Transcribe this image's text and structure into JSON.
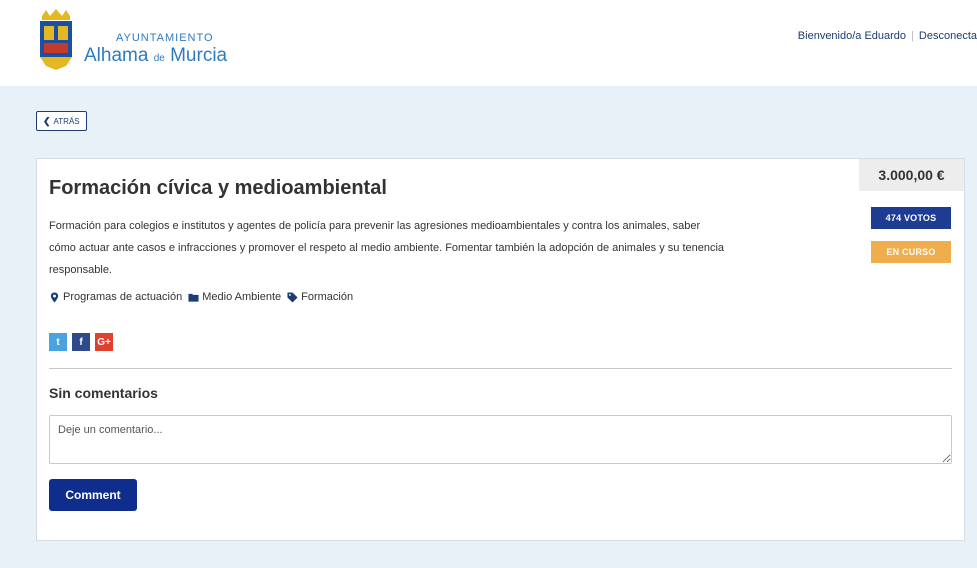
{
  "header": {
    "logo_top": "AYUNTAMIENTO",
    "logo_main": "Alhama",
    "logo_de": "de",
    "logo_city": "Murcia",
    "welcome": "Bienvenido/a Eduardo",
    "logout": "Desconecta"
  },
  "back": {
    "label": "ATRÁS"
  },
  "project": {
    "title": "Formación cívica y medioambiental",
    "description": "Formación para colegios e institutos y agentes de policía para prevenir las agresiones medioambientales y contra los animales, saber cómo actuar ante casos e infracciones y promover el respeto al medio ambiente. Fomentar también la adopción de animales y su tenencia responsable.",
    "price": "3.000,00 €",
    "votes": "474 VOTOS",
    "status": "EN CURSO",
    "meta": {
      "program": "Programas de actuación",
      "category": "Medio Ambiente",
      "tag": "Formación"
    }
  },
  "social": {
    "twitter": "t",
    "facebook": "f",
    "google": "G+"
  },
  "comments": {
    "title": "Sin comentarios",
    "placeholder": "Deje un comentario...",
    "button": "Comment"
  },
  "colors": {
    "accent": "#1d3c92",
    "status": "#f0ad4e",
    "background": "#e8f0f8"
  }
}
